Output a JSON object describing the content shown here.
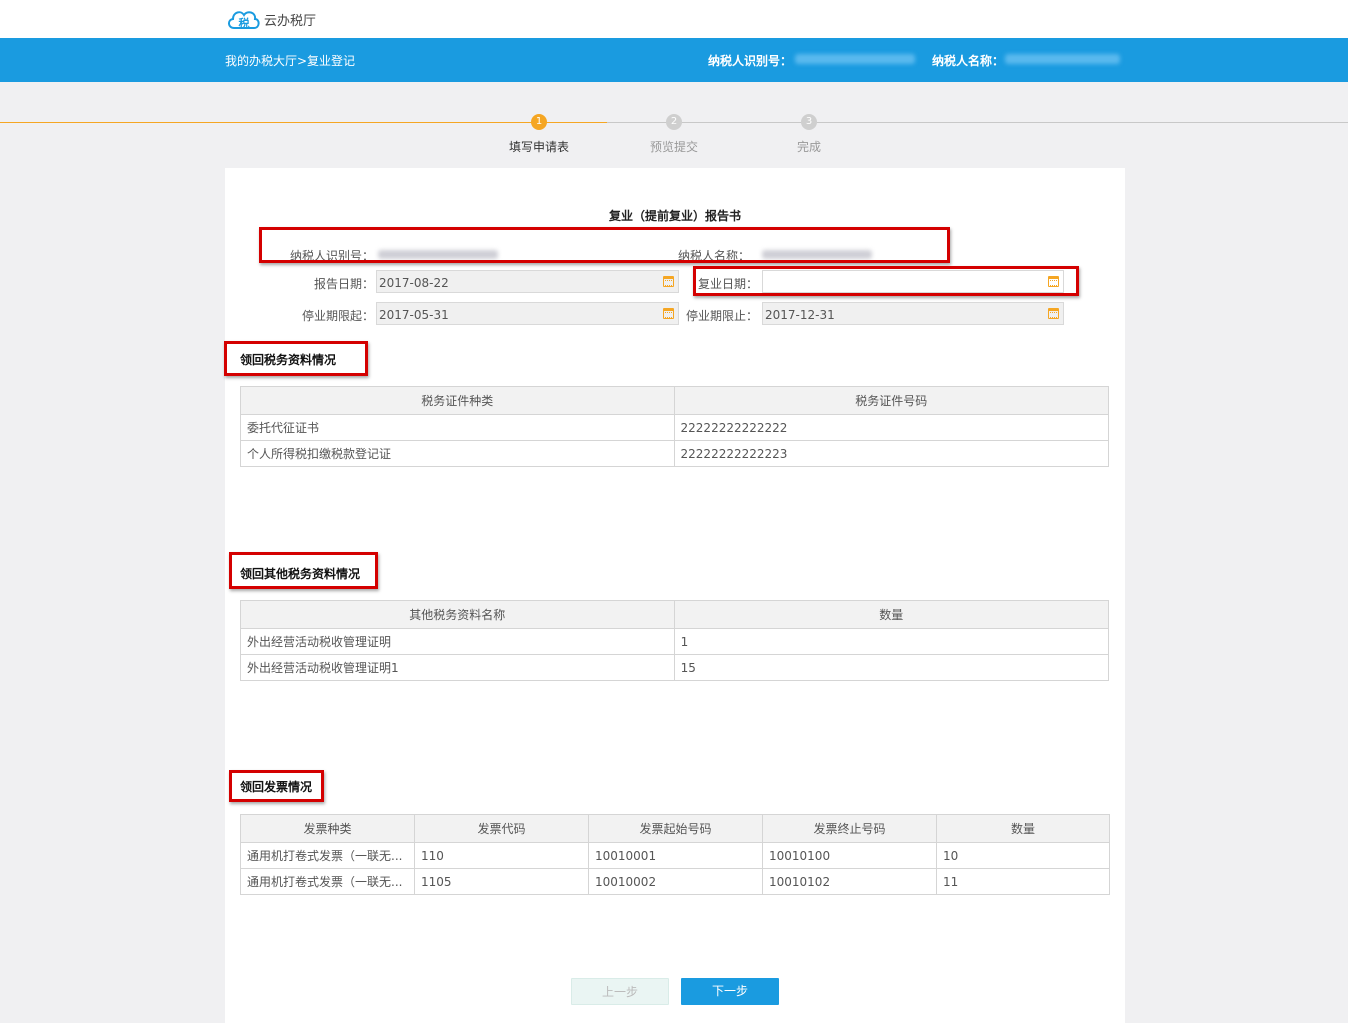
{
  "header": {
    "app_name": "云办税厅",
    "logo_char": "税",
    "breadcrumb": "我的办税大厅>复业登记",
    "taxid_label": "纳税人识别号：",
    "taxname_label": "纳税人名称："
  },
  "steps": [
    {
      "num": "1",
      "label": "填写申请表",
      "state": "active"
    },
    {
      "num": "2",
      "label": "预览提交",
      "state": "inactive"
    },
    {
      "num": "3",
      "label": "完成",
      "state": "inactive"
    }
  ],
  "form": {
    "title": "复业（提前复业）报告书",
    "taxid_label": "纳税人识别号：",
    "taxname_label": "纳税人名称：",
    "report_date_label": "报告日期：",
    "report_date_value": "2017-08-22",
    "resume_date_label": "复业日期：",
    "resume_date_value": "",
    "suspend_start_label": "停业期限起：",
    "suspend_start_value": "2017-05-31",
    "suspend_end_label": "停业期限止：",
    "suspend_end_value": "2017-12-31"
  },
  "section1": {
    "title": "领回税务资料情况",
    "headers": [
      "税务证件种类",
      "税务证件号码"
    ],
    "rows": [
      [
        "委托代征证书",
        "22222222222222"
      ],
      [
        "个人所得税扣缴税款登记证",
        "22222222222223"
      ]
    ]
  },
  "section2": {
    "title": "领回其他税务资料情况",
    "headers": [
      "其他税务资料名称",
      "数量"
    ],
    "rows": [
      [
        "外出经营活动税收管理证明",
        "1"
      ],
      [
        "外出经营活动税收管理证明1",
        "15"
      ]
    ]
  },
  "section3": {
    "title": "领回发票情况",
    "headers": [
      "发票种类",
      "发票代码",
      "发票起始号码",
      "发票终止号码",
      "数量"
    ],
    "rows": [
      [
        "通用机打卷式发票（一联无...",
        "110",
        "10010001",
        "10010100",
        "10"
      ],
      [
        "通用机打卷式发票（一联无...",
        "1105",
        "10010002",
        "10010102",
        "11"
      ]
    ]
  },
  "buttons": {
    "prev": "上一步",
    "next": "下一步"
  },
  "colors": {
    "brand_blue": "#1a9be0",
    "step_active": "#f5a623",
    "highlight_red": "#d40000"
  }
}
